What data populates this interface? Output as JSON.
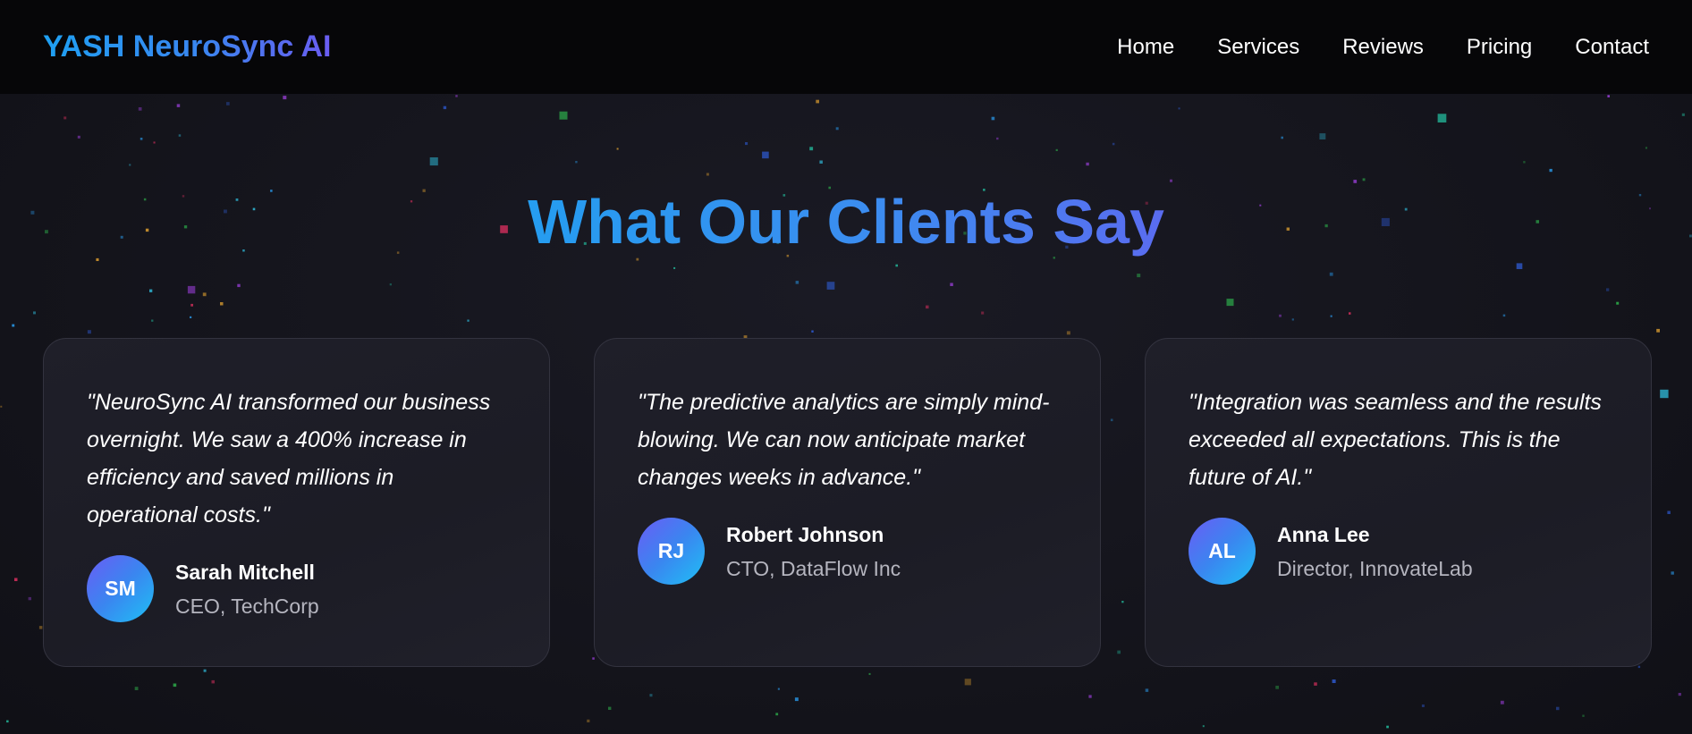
{
  "brand": {
    "logo_text": "YASH NeuroSync AI"
  },
  "nav": {
    "items": [
      {
        "label": "Home"
      },
      {
        "label": "Services"
      },
      {
        "label": "Reviews"
      },
      {
        "label": "Pricing"
      },
      {
        "label": "Contact"
      }
    ]
  },
  "testimonials": {
    "title": "What Our Clients Say",
    "items": [
      {
        "quote": "\"NeuroSync AI transformed our business overnight. We saw a 400% increase in efficiency and saved millions in operational costs.\"",
        "initials": "SM",
        "name": "Sarah Mitchell",
        "role": "CEO, TechCorp"
      },
      {
        "quote": "\"The predictive analytics are simply mind-blowing. We can now anticipate market changes weeks in advance.\"",
        "initials": "RJ",
        "name": "Robert Johnson",
        "role": "CTO, DataFlow Inc"
      },
      {
        "quote": "\"Integration was seamless and the results exceeded all expectations. This is the future of AI.\"",
        "initials": "AL",
        "name": "Anna Lee",
        "role": "Director, InnovateLab"
      }
    ]
  },
  "colors": {
    "accent_blue": "#259df0",
    "accent_purple": "#6a5cf0",
    "background": "#14141c",
    "card_background": "#1e1e28",
    "nav_background": "#060608"
  }
}
